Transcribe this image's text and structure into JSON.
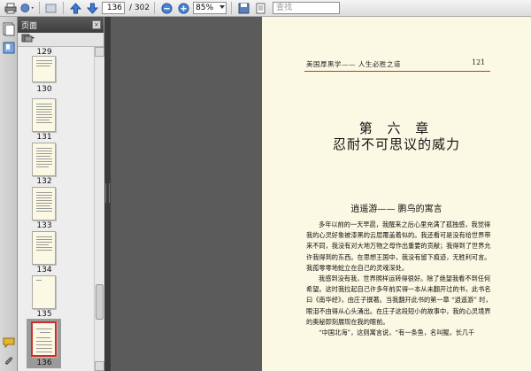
{
  "toolbar": {
    "page_current": "136",
    "page_total": "/ 302",
    "zoom": "85%",
    "search_placeholder": "查找",
    "icons": [
      "print-icon",
      "stamp-icon",
      "back-icon",
      "up-arrow-icon",
      "down-arrow-icon",
      "zoom-out-icon",
      "zoom-in-icon",
      "save-icon",
      "fit-page-icon"
    ]
  },
  "panel": {
    "title": "页面",
    "close_symbol": "×",
    "thumbnails": [
      {
        "label": "129"
      },
      {
        "label": "130"
      },
      {
        "label": "131"
      },
      {
        "label": "132"
      },
      {
        "label": "133"
      },
      {
        "label": "134"
      },
      {
        "label": "135"
      },
      {
        "label": "136"
      }
    ],
    "selected_page": "136"
  },
  "document": {
    "running_head": "美国厚黑学—— 人生必胜之道",
    "page_number": "121",
    "chapter_no": "第 六 章",
    "chapter_title": "忍耐不可思议的威力",
    "section_title": "逍遥游—— 鹏鸟的寓言",
    "paragraphs": [
      "多年以前的一天早晨，我醒来之后心里充满了孤独感，我觉得我的心灵好象被漆黑的云层覆盖着似的。我还看可是没有给世界带来不同，我没有对大地万物之母作出重要的贡献；我得到了世界允许我得到的东西。在思想王国中，我没有留下痕迹，无胜利可言。我孤零零地蛇立在自己的灵魂深处。",
      "我感到没有我，世界照样运转得很好。除了绝望我看不到任何希望。这时我拉起自己许多年前买得一本从未翻开过的书，此书名曰《南华经》，由庄子撰著。当我翻开此书的第一章 “逍遥游” 时，眼泪不由得从心头涌出。在庄子这段短小的故事中，我的心灵境界的奥秘即刻展现在我的眼前。",
      "“中国北海”，这则寓言说，“有一条鱼，名叫鲲，长几千"
    ]
  }
}
